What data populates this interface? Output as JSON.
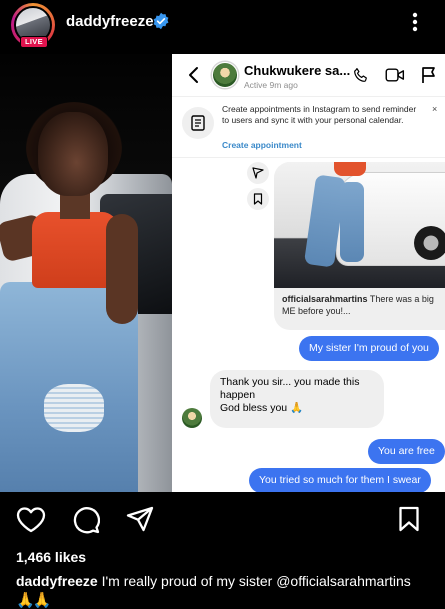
{
  "post": {
    "username": "daddyfreeze",
    "live_badge": "LIVE",
    "likes": "1,466 likes",
    "caption_user": "daddyfreeze",
    "caption_text": " I'm really proud of my sister @officialsarahmartins",
    "caption_emoji": "🙏🙏"
  },
  "dm": {
    "contact_name": "Chukwukere sa...",
    "status": "Active 9m ago",
    "notice_text": "Create appointments in Instagram to send reminder to users and sync it with your personal calendar.",
    "notice_link": "Create appointment",
    "notice_close": "×",
    "shared_post_user": "officialsarahmartins",
    "shared_post_caption": " There was a big ME before you!...",
    "messages": [
      {
        "side": "out",
        "text": "My sister I'm proud of you"
      },
      {
        "side": "in",
        "text": "Thank you sir... you made this happen\nGod bless you 🙏"
      },
      {
        "side": "out",
        "text": "You are free"
      },
      {
        "side": "out",
        "text": "You tried so much for them I swear"
      }
    ]
  },
  "colors": {
    "live": "#e0134e",
    "verified": "#3897f0",
    "outgoing_bubble": "#3c74f0",
    "incoming_bubble": "#efefef",
    "link": "#3a89c9"
  }
}
